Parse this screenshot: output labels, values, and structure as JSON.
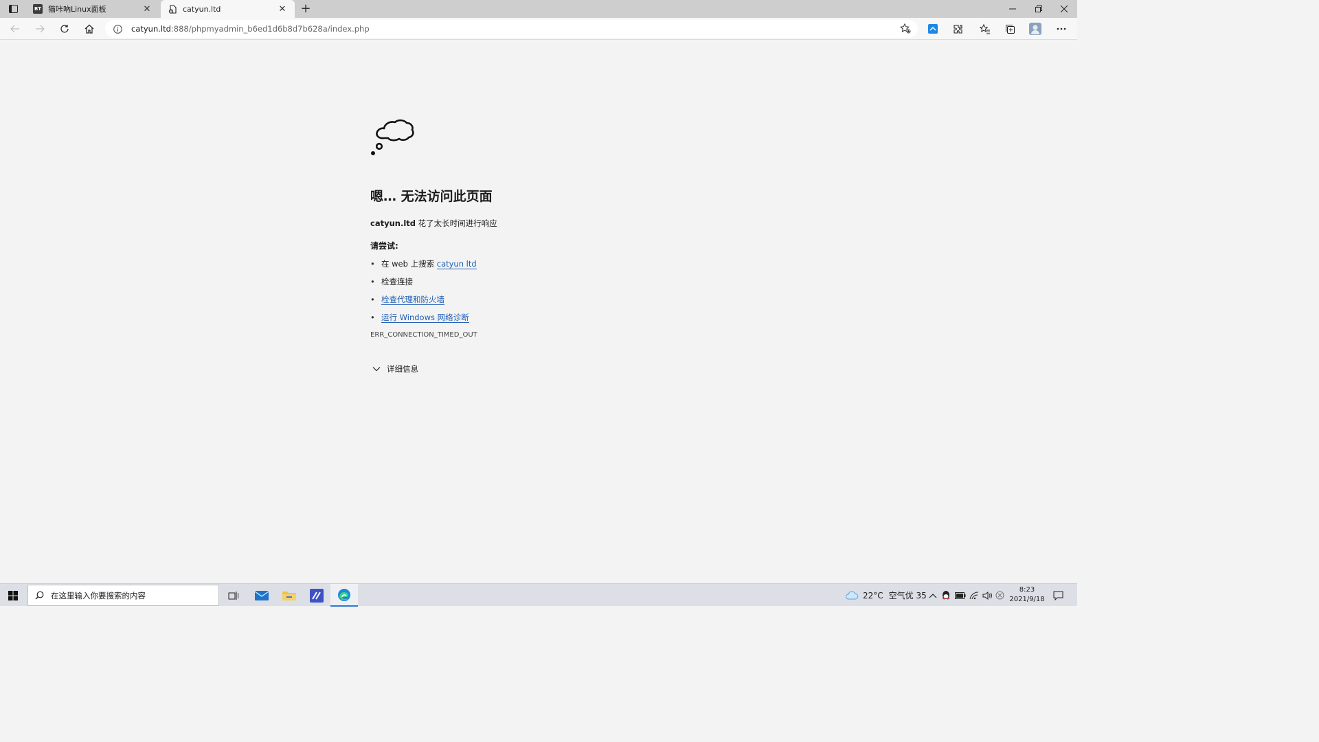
{
  "tabs": [
    {
      "title": "猫咔吶Linux面板",
      "favicon": "BT"
    },
    {
      "title": "catyun.ltd"
    }
  ],
  "address": {
    "host": "catyun.ltd",
    "path": ":888/phpmyadmin_b6ed1d6b8d7b628a/index.php"
  },
  "error": {
    "title": "嗯… 无法访问此页面",
    "host": "catyun.ltd",
    "message": "花了太长时间进行响应",
    "try_label": "请尝试:",
    "suggestions": [
      {
        "prefix": "在 web 上搜索",
        "link": "catyun ltd"
      },
      {
        "text": "检查连接"
      },
      {
        "link": "检查代理和防火墙"
      },
      {
        "link": "运行 Windows 网络诊断"
      }
    ],
    "code": "ERR_CONNECTION_TIMED_OUT",
    "details_label": "详细信息"
  },
  "taskbar": {
    "search_placeholder": "在这里输入你要搜索的内容",
    "weather_temp": "22°C",
    "air_quality": "空气优 35",
    "time": "8:23",
    "date": "2021/9/18"
  },
  "colors": {
    "link": "#1f5fb5",
    "content_bg": "#f3f3f3",
    "tabstrip_bg": "#cecece",
    "taskbar_bg": "#dcdfe5",
    "active_indicator": "#2b79d6"
  }
}
